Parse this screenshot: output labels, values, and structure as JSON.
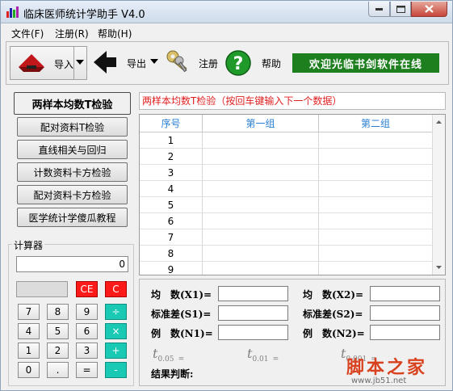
{
  "window": {
    "title": "临床医师统计学助手 V4.0",
    "icon": "bar-chart-icon"
  },
  "menu": [
    "文件(F)",
    "注册(R)",
    "帮助(H)"
  ],
  "toolbar": {
    "import_label": "导入",
    "export_label": "导出",
    "register_label": "注册",
    "help_label": "帮助",
    "banner": "欢迎光临书剑软件在线",
    "banner_color": "#1e7f1f"
  },
  "left_buttons": [
    "两样本均数T检验",
    "配对资料T检验",
    "直线相关与回归",
    "计数资料卡方检验",
    "配对资料卡方检验",
    "医学统计学傻瓜教程"
  ],
  "calculator": {
    "legend": "计算器",
    "display": "0",
    "ce": "CE",
    "c": "C",
    "keys": [
      [
        "7",
        "8",
        "9",
        "÷"
      ],
      [
        "4",
        "5",
        "6",
        "×"
      ],
      [
        "1",
        "2",
        "3",
        "+"
      ],
      [
        "0",
        ".",
        "=",
        "-"
      ]
    ]
  },
  "panel": {
    "header": "两样本均数T检验（按回车键输入下一个数据）",
    "columns": [
      "序号",
      "第一组",
      "第二组"
    ],
    "rows": [
      "1",
      "2",
      "3",
      "4",
      "5",
      "6",
      "7",
      "8",
      "9"
    ]
  },
  "stats": {
    "mean1": "均　数(X1)=",
    "mean2": "均　数(X2)=",
    "sd1": "标准差(S1)=",
    "sd2": "标准差(S2)=",
    "n1": "例　数(N1)=",
    "n2": "例　数(N2)=",
    "t005_main": "t",
    "t005_sub": "0.05",
    "t005_eq": "=",
    "t001_main": "t",
    "t001_sub": "0.01",
    "t001_eq": "=",
    "t0001_main": "t",
    "t0001_sub": "0.001",
    "t0001_eq": "=",
    "result": "结果判断:"
  },
  "watermark": {
    "main": "脚本之家",
    "url": "www.jb51.net"
  }
}
